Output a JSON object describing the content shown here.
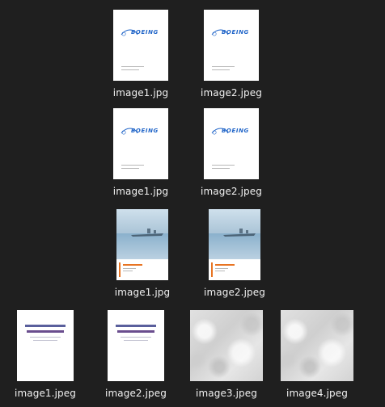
{
  "files": [
    {
      "id": "r1c1",
      "name": "image1.jpg",
      "kind": "boeing"
    },
    {
      "id": "r1c2",
      "name": "image2.jpeg",
      "kind": "boeing"
    },
    {
      "id": "r2c1",
      "name": "image1.jpg",
      "kind": "boeing"
    },
    {
      "id": "r2c2",
      "name": "image2.jpeg",
      "kind": "boeing"
    },
    {
      "id": "r3c1",
      "name": "image1.jpg",
      "kind": "water"
    },
    {
      "id": "r3c2",
      "name": "image2.jpeg",
      "kind": "water"
    },
    {
      "id": "r4c1",
      "name": "image1.jpeg",
      "kind": "doc"
    },
    {
      "id": "r4c2",
      "name": "image2.jpeg",
      "kind": "doc"
    },
    {
      "id": "r4c3",
      "name": "image3.jpeg",
      "kind": "marble"
    },
    {
      "id": "r4c4",
      "name": "image4.jpeg",
      "kind": "marble"
    }
  ],
  "colors": {
    "background": "#1f1f1f",
    "text": "#f2f2f2",
    "boeing_blue": "#1f64c8",
    "accent_orange": "#e87422"
  }
}
